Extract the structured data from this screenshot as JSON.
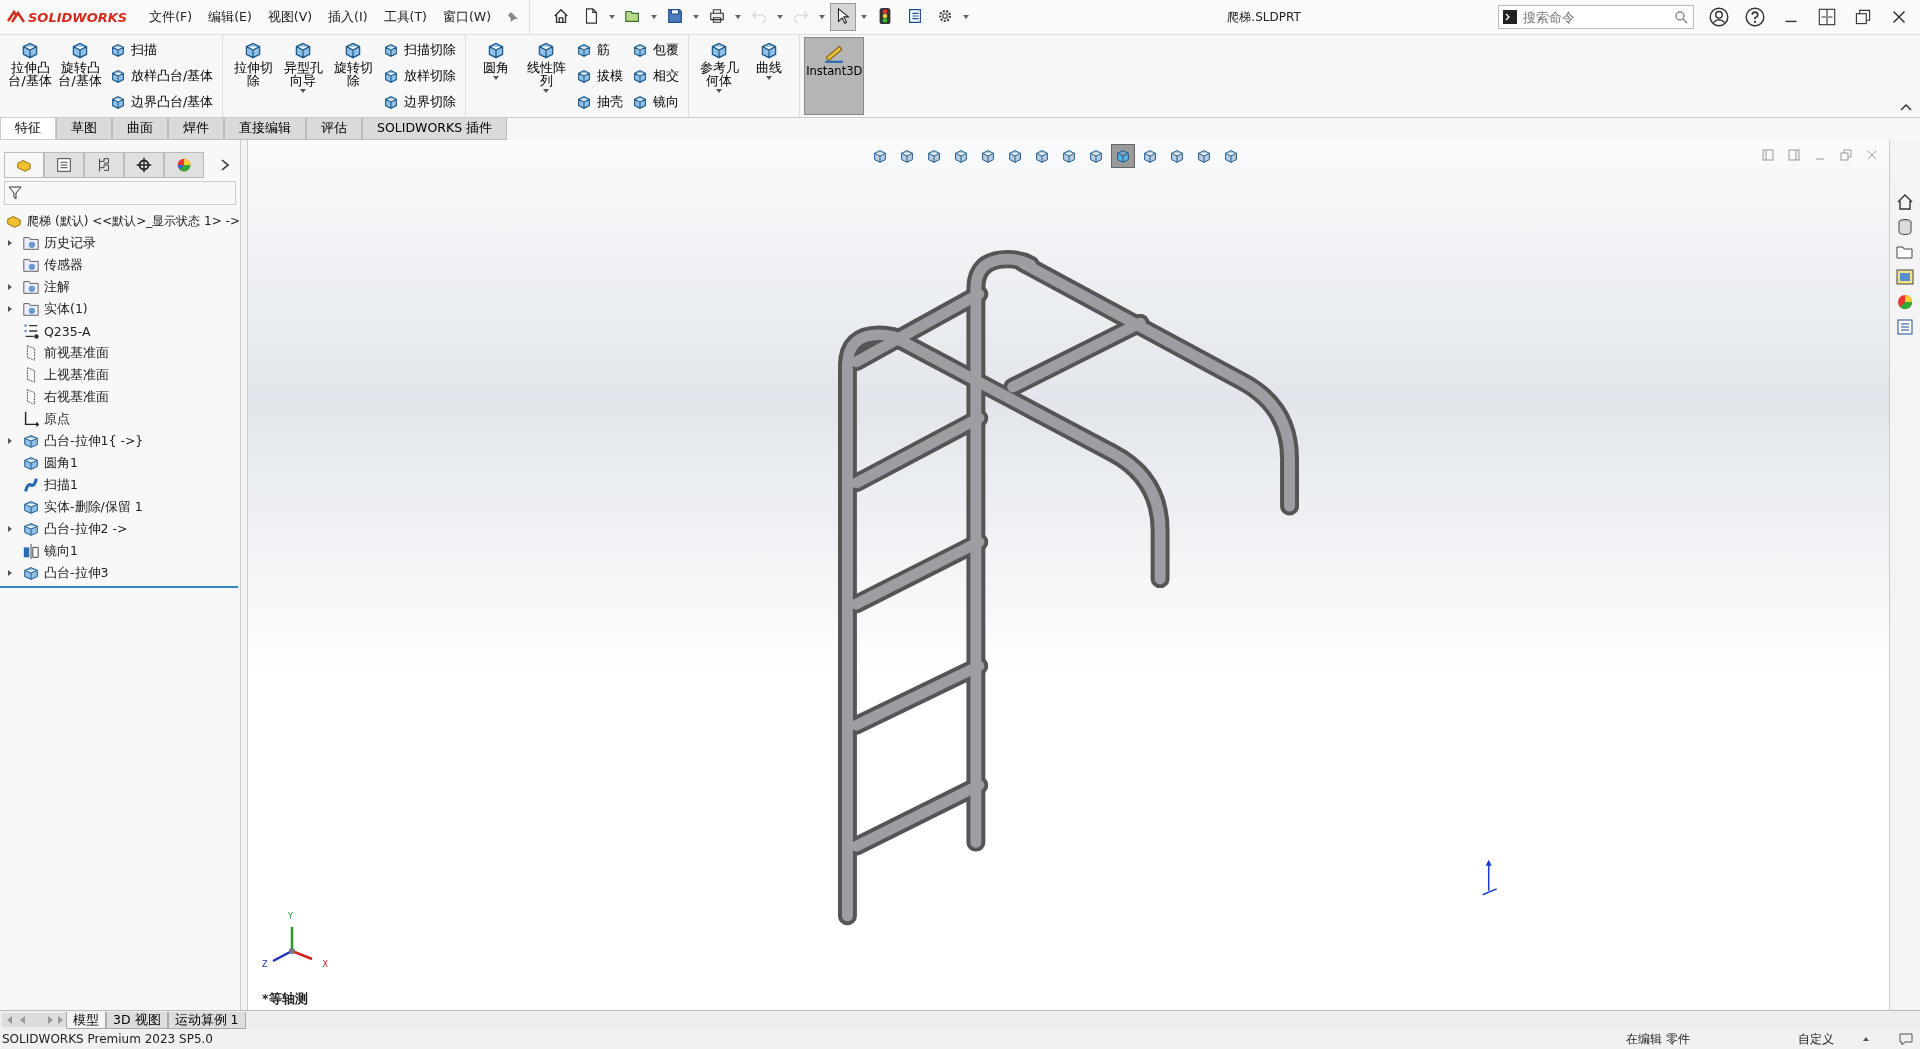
{
  "app": {
    "logo": "SOLIDWORKS",
    "document_title": "爬梯.SLDPRT"
  },
  "menu": [
    "文件(F)",
    "编辑(E)",
    "视图(V)",
    "插入(I)",
    "工具(T)",
    "窗口(W)"
  ],
  "quick_tools": [
    {
      "kind": "home",
      "selected": false,
      "disabled": false
    },
    {
      "kind": "new",
      "selected": false,
      "disabled": false
    },
    {
      "kind": "open",
      "selected": false,
      "disabled": false
    },
    {
      "kind": "save",
      "selected": false,
      "disabled": false
    },
    {
      "kind": "print",
      "selected": false,
      "disabled": false
    },
    {
      "kind": "undo",
      "selected": false,
      "disabled": true
    },
    {
      "kind": "redo",
      "selected": false,
      "disabled": true
    },
    {
      "kind": "select",
      "selected": true,
      "disabled": false
    },
    {
      "kind": "light",
      "selected": false,
      "disabled": false
    },
    {
      "kind": "list",
      "selected": false,
      "disabled": false
    },
    {
      "kind": "gear",
      "selected": false,
      "disabled": false
    }
  ],
  "search": {
    "placeholder": "搜索命令"
  },
  "ribbon": [
    {
      "large": [
        {
          "label": "拉伸凸台/基体",
          "dropdown": false
        },
        {
          "label": "旋转凸台/基体",
          "dropdown": false
        }
      ],
      "columns": [
        [
          "扫描",
          "放样凸台/基体",
          "边界凸台/基体"
        ]
      ]
    },
    {
      "large": [
        {
          "label": "拉伸切除",
          "dropdown": false
        },
        {
          "label": "异型孔向导",
          "dropdown": true
        },
        {
          "label": "旋转切除",
          "dropdown": false
        }
      ],
      "columns": [
        [
          "扫描切除",
          "放样切除",
          "边界切除"
        ]
      ]
    },
    {
      "large": [
        {
          "label": "圆角",
          "dropdown": true
        },
        {
          "label": "线性阵列",
          "dropdown": true
        }
      ],
      "columns": [
        [
          "筋",
          "拔模",
          "抽壳"
        ],
        [
          "包覆",
          "相交",
          "镜向"
        ]
      ]
    },
    {
      "large": [
        {
          "label": "参考几何体",
          "dropdown": true
        },
        {
          "label": "曲线",
          "dropdown": true
        }
      ]
    }
  ],
  "instant3d": {
    "label": "Instant3D",
    "selected": true
  },
  "tabs": [
    {
      "label": "特征",
      "selected": true
    },
    {
      "label": "草图",
      "selected": false
    },
    {
      "label": "曲面",
      "selected": false
    },
    {
      "label": "焊件",
      "selected": false
    },
    {
      "label": "直接编辑",
      "selected": false
    },
    {
      "label": "评估",
      "selected": false
    },
    {
      "label": "SOLIDWORKS 插件",
      "selected": false
    }
  ],
  "view_tools": [
    {
      "selected": false
    },
    {
      "selected": false
    },
    {
      "selected": false
    },
    {
      "selected": false
    },
    {
      "selected": false
    },
    {
      "selected": false
    },
    {
      "selected": false
    },
    {
      "selected": false
    },
    {
      "selected": false
    },
    {
      "selected": true
    },
    {
      "selected": false
    },
    {
      "selected": false
    },
    {
      "selected": false
    },
    {
      "selected": false
    }
  ],
  "tree": {
    "root": "爬梯 (默认) <<默认>_显示状态 1> ->",
    "items": [
      {
        "label": "历史记录",
        "kind": "folder",
        "has_children": true
      },
      {
        "label": "传感器",
        "kind": "folder",
        "has_children": false
      },
      {
        "label": "注解",
        "kind": "folder",
        "has_children": true
      },
      {
        "label": "实体(1)",
        "kind": "folder",
        "has_children": true
      },
      {
        "label": "Q235-A",
        "kind": "material",
        "has_children": false
      },
      {
        "label": "前视基准面",
        "kind": "plane",
        "has_children": false
      },
      {
        "label": "上视基准面",
        "kind": "plane",
        "has_children": false
      },
      {
        "label": "右视基准面",
        "kind": "plane",
        "has_children": false
      },
      {
        "label": "原点",
        "kind": "origin",
        "has_children": false
      },
      {
        "label": "凸台-拉伸1{ ->}",
        "kind": "feature",
        "has_children": true
      },
      {
        "label": "圆角1",
        "kind": "feature",
        "has_children": false
      },
      {
        "label": "扫描1",
        "kind": "sweep",
        "has_children": false
      },
      {
        "label": "实体-删除/保留 1",
        "kind": "feature",
        "has_children": false
      },
      {
        "label": "凸台-拉伸2 ->",
        "kind": "feature",
        "has_children": true
      },
      {
        "label": "镜向1",
        "kind": "mirror",
        "has_children": false
      },
      {
        "label": "凸台-拉伸3",
        "kind": "feature",
        "has_children": true
      }
    ]
  },
  "triad": {
    "x": "X",
    "y": "Y",
    "z": "Z"
  },
  "view_label": "*等轴测",
  "bottom_tabs": [
    {
      "label": "模型",
      "selected": true
    },
    {
      "label": "3D 视图",
      "selected": false
    },
    {
      "label": "运动算例 1",
      "selected": false
    }
  ],
  "status": {
    "product": "SOLIDWORKS Premium 2023 SP5.0",
    "mode": "在编辑 零件",
    "units": "自定义"
  }
}
